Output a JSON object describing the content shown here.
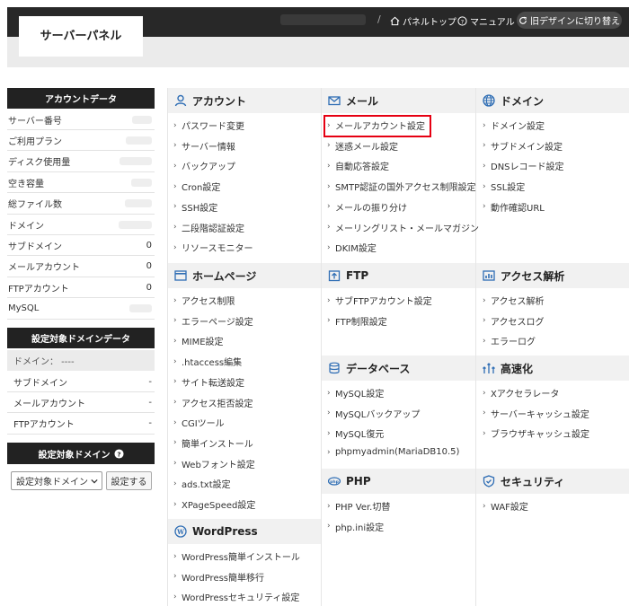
{
  "header": {
    "logo": "サーバーパネル",
    "sep": "/",
    "panel_top": "パネルトップ",
    "manual": "マニュアル",
    "old_design": "旧デザインに切り替え"
  },
  "sidebar": {
    "account_title": "アカウントデータ",
    "account_rows": [
      {
        "label": "サーバー番号",
        "value": ""
      },
      {
        "label": "ご利用プラン",
        "value": ""
      },
      {
        "label": "ディスク使用量",
        "value": ""
      },
      {
        "label": "空き容量",
        "value": ""
      },
      {
        "label": "総ファイル数",
        "value": ""
      },
      {
        "label": "ドメイン",
        "value": ""
      },
      {
        "label": "サブドメイン",
        "value": "0"
      },
      {
        "label": "メールアカウント",
        "value": "0"
      },
      {
        "label": "FTPアカウント",
        "value": "0"
      },
      {
        "label": "MySQL",
        "value": ""
      }
    ],
    "domain_title": "設定対象ドメインデータ",
    "domain_label": "ドメイン： ----",
    "domain_rows": [
      {
        "label": "サブドメイン",
        "value": "-"
      },
      {
        "label": "メールアカウント",
        "value": "-"
      },
      {
        "label": "FTPアカウント",
        "value": "-"
      }
    ],
    "target_title": "設定対象ドメイン",
    "target_select": "設定対象ドメイン",
    "target_button": "設定する"
  },
  "sections": {
    "account": {
      "title": "アカウント",
      "items": [
        "パスワード変更",
        "サーバー情報",
        "バックアップ",
        "Cron設定",
        "SSH設定",
        "二段階認証設定",
        "リソースモニター"
      ]
    },
    "mail": {
      "title": "メール",
      "items": [
        "メールアカウント設定",
        "迷惑メール設定",
        "自動応答設定",
        "SMTP認証の国外アクセス制限設定",
        "メールの振り分け",
        "メーリングリスト・メールマガジン",
        "DKIM設定"
      ]
    },
    "domain": {
      "title": "ドメイン",
      "items": [
        "ドメイン設定",
        "サブドメイン設定",
        "DNSレコード設定",
        "SSL設定",
        "動作確認URL"
      ]
    },
    "homepage": {
      "title": "ホームページ",
      "items": [
        "アクセス制限",
        "エラーページ設定",
        "MIME設定",
        ".htaccess編集",
        "サイト転送設定",
        "アクセス拒否設定",
        "CGIツール",
        "簡単インストール",
        "Webフォント設定",
        "ads.txt設定",
        "XPageSpeed設定"
      ]
    },
    "ftp": {
      "title": "FTP",
      "items": [
        "サブFTPアカウント設定",
        "FTP制限設定"
      ]
    },
    "analytics": {
      "title": "アクセス解析",
      "items": [
        "アクセス解析",
        "アクセスログ",
        "エラーログ"
      ]
    },
    "database": {
      "title": "データベース",
      "items": [
        "MySQL設定",
        "MySQLバックアップ",
        "MySQL復元",
        "phpmyadmin(MariaDB10.5)"
      ]
    },
    "speed": {
      "title": "高速化",
      "items": [
        "Xアクセラレータ",
        "サーバーキャッシュ設定",
        "ブラウザキャッシュ設定"
      ]
    },
    "php": {
      "title": "PHP",
      "items": [
        "PHP Ver.切替",
        "php.ini設定"
      ]
    },
    "security": {
      "title": "セキュリティ",
      "items": [
        "WAF設定"
      ]
    },
    "wordpress": {
      "title": "WordPress",
      "items": [
        "WordPress簡単インストール",
        "WordPress簡単移行",
        "WordPressセキュリティ設定"
      ]
    }
  },
  "highlight": {
    "target": "メールアカウント設定",
    "color": "#e60012"
  }
}
